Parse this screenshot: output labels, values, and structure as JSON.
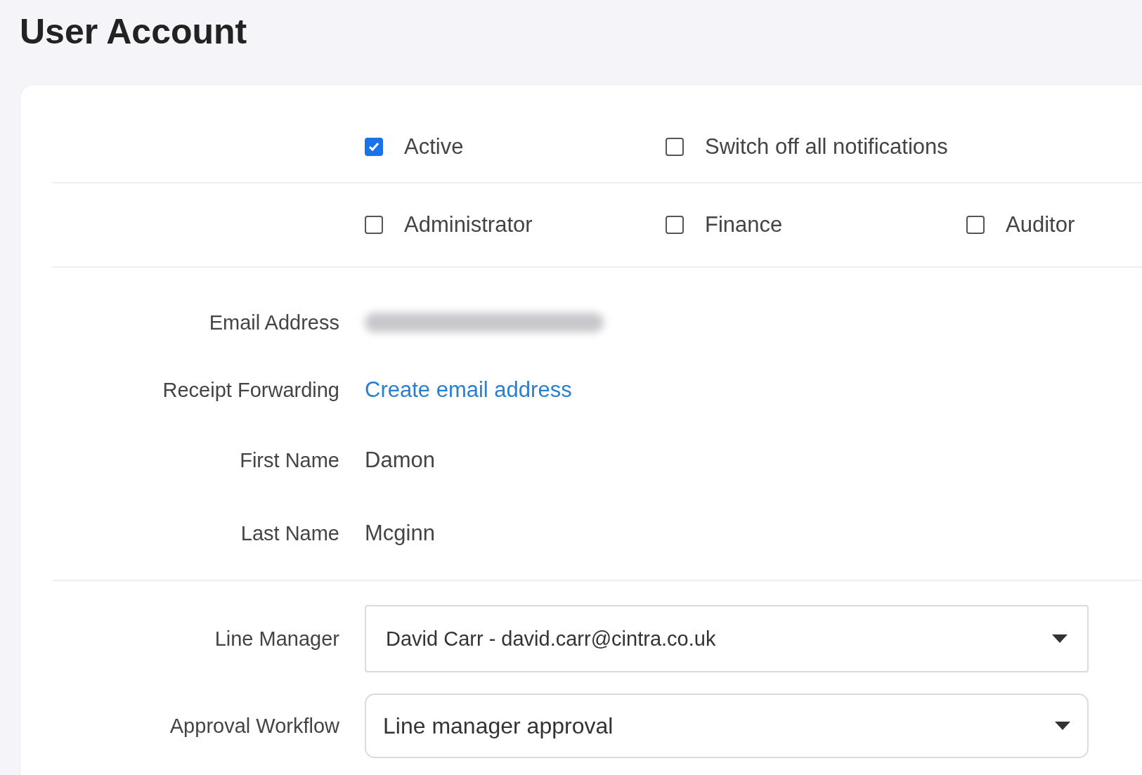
{
  "title": "User Account",
  "checkbox_rows": [
    {
      "items": [
        {
          "label": "Active",
          "checked": true
        },
        {
          "label": "Switch off all notifications",
          "checked": false
        }
      ]
    },
    {
      "items": [
        {
          "label": "Administrator",
          "checked": false
        },
        {
          "label": "Finance",
          "checked": false
        },
        {
          "label": "Auditor",
          "checked": false
        }
      ]
    }
  ],
  "details": [
    {
      "label": "Email Address",
      "kind": "redacted"
    },
    {
      "label": "Receipt Forwarding",
      "kind": "link",
      "value": "Create email address"
    },
    {
      "label": "First Name",
      "kind": "text",
      "value": "Damon"
    },
    {
      "label": "Last Name",
      "kind": "text",
      "value": "Mcginn"
    }
  ],
  "selects": [
    {
      "label": "Line Manager",
      "value": "David Carr - david.carr@cintra.co.uk"
    },
    {
      "label": "Approval Workflow",
      "value": "Line manager approval"
    }
  ]
}
